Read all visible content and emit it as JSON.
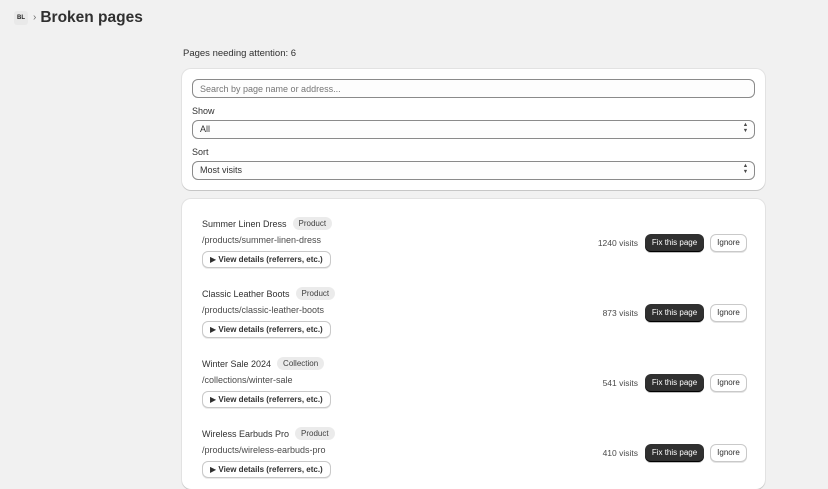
{
  "header": {
    "app_icon": "BL",
    "breadcrumb_separator": "›",
    "title": "Broken pages"
  },
  "summary": {
    "pages_needing_attention": "Pages needing attention: 6"
  },
  "filters": {
    "search": {
      "placeholder": "Search by page name or address..."
    },
    "show": {
      "label": "Show",
      "value": "All"
    },
    "sort": {
      "label": "Sort",
      "value": "Most visits"
    }
  },
  "pages": [
    {
      "name": "Summer Linen Dress",
      "type": "Product",
      "path": "/products/summer-linen-dress",
      "details_label": "▶ View details (referrers, etc.)",
      "visits": "1240 visits",
      "fix_label": "Fix this page",
      "ignore_label": "Ignore"
    },
    {
      "name": "Classic Leather Boots",
      "type": "Product",
      "path": "/products/classic-leather-boots",
      "details_label": "▶ View details (referrers, etc.)",
      "visits": "873 visits",
      "fix_label": "Fix this page",
      "ignore_label": "Ignore"
    },
    {
      "name": "Winter Sale 2024",
      "type": "Collection",
      "path": "/collections/winter-sale",
      "details_label": "▶ View details (referrers, etc.)",
      "visits": "541 visits",
      "fix_label": "Fix this page",
      "ignore_label": "Ignore"
    },
    {
      "name": "Wireless Earbuds Pro",
      "type": "Product",
      "path": "/products/wireless-earbuds-pro",
      "details_label": "▶ View details (referrers, etc.)",
      "visits": "410 visits",
      "fix_label": "Fix this page",
      "ignore_label": "Ignore"
    }
  ],
  "colors": {
    "background": "#f1f1f1",
    "card": "#ffffff",
    "primary_button": "#303030",
    "badge": "#ebebeb"
  }
}
